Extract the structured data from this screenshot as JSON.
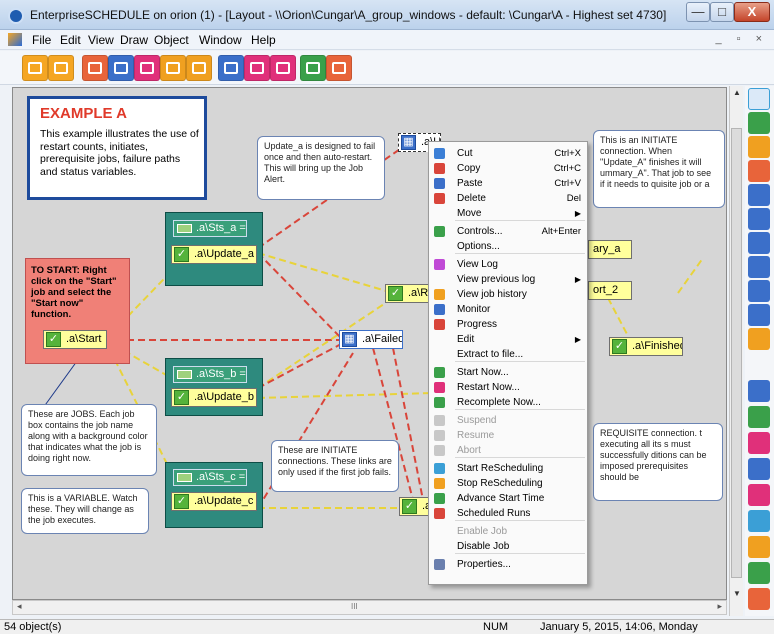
{
  "window": {
    "title": "EnterpriseSCHEDULE on orion  (1) - [Layout - \\\\Orion\\Cungar\\A_group_windows - default: \\Cungar\\A - Highest set 4730]",
    "minimize": "—",
    "maximize": "□",
    "close": "X"
  },
  "menubar": {
    "items": [
      "File",
      "Edit",
      "View",
      "Draw",
      "Object",
      "Window",
      "Help"
    ],
    "mdi_controls": "_ ▫ ×"
  },
  "toolbar": {
    "colors": [
      "#f5a623",
      "#f5a623",
      "#e8643a",
      "#3b6fc9",
      "#e0307a",
      "#f0a020",
      "#f0a020",
      "#3b6fc9",
      "#e0307a",
      "#e0307a",
      "#3aa04a",
      "#e8643a"
    ]
  },
  "diagram": {
    "example_title": "EXAMPLE A",
    "example_text": "This example illustrates the use of restart counts, initiates, prerequisite jobs, failure paths and status variables.",
    "start_note": "TO START: Right click on the \"Start\" job and select the \"Start now\" function.",
    "jobs": {
      "start": ".a\\Start",
      "update_a": ".a\\Update_a",
      "update_b": ".a\\Update_b",
      "update_c": ".a\\Update_c",
      "rep": ".a\\Rep",
      "failed": ".a\\Failed",
      "finished": ".a\\Finished",
      "update_a_failed": ".a\\Update_a_failed",
      "ary_a": "ary_a",
      "ort_2": "ort_2",
      "al": ".a\\"
    },
    "vars": {
      "sts_a": ".a\\Sts_a =",
      "sts_b": ".a\\Sts_b =",
      "sts_c": ".a\\Sts_c ="
    },
    "notes": {
      "update_note": "Update_a is designed to fail once and then auto-restart. This will bring up the Job Alert.",
      "initiate_note": "This is an INITIATE connection.  When \"Update_A\" finishes it will ummary_A\". That job  to see if it needs to quisite job or a",
      "jobs_note": "These are JOBS.  Each job box contains the job name along with a background color that indicates what the job is doing right now.",
      "initiate_conn_note": "These are INITIATE connections.  These links are only used if the first job fails.",
      "prereq_note": "REQUISITE connection. t executing all its s must successfully ditions can be imposed prerequisites should be",
      "variable_note": "This is a VARIABLE.  Watch these. They will change as the job executes."
    }
  },
  "context_menu": {
    "items": [
      {
        "label": "Cut",
        "shortcut": "Ctrl+X",
        "icon": "cut-icon",
        "color": "#3b7fd6",
        "disabled": false
      },
      {
        "label": "Copy",
        "shortcut": "Ctrl+C",
        "icon": "copy-icon",
        "color": "#d9453a",
        "disabled": false
      },
      {
        "label": "Paste",
        "shortcut": "Ctrl+V",
        "icon": "paste-icon",
        "color": "#3b6fc9",
        "disabled": false
      },
      {
        "label": "Delete",
        "shortcut": "Del",
        "icon": "delete-icon",
        "color": "#d9453a",
        "disabled": false
      },
      {
        "label": "Move",
        "shortcut": "",
        "icon": "",
        "color": "",
        "disabled": false,
        "submenu": true
      },
      {
        "label": "Controls...",
        "shortcut": "Alt+Enter",
        "icon": "controls-icon",
        "color": "#3aa04a",
        "disabled": false
      },
      {
        "label": "Options...",
        "shortcut": "",
        "icon": "",
        "color": "",
        "disabled": false
      },
      {
        "label": "View Log",
        "shortcut": "",
        "icon": "log-icon",
        "color": "#c04ad6",
        "disabled": false
      },
      {
        "label": "View previous log",
        "shortcut": "",
        "icon": "",
        "color": "",
        "disabled": false,
        "submenu": true
      },
      {
        "label": "View job history",
        "shortcut": "",
        "icon": "history-icon",
        "color": "#f0a020",
        "disabled": false
      },
      {
        "label": "Monitor",
        "shortcut": "",
        "icon": "monitor-icon",
        "color": "#3b6fc9",
        "disabled": false
      },
      {
        "label": "Progress",
        "shortcut": "",
        "icon": "progress-icon",
        "color": "#d9453a",
        "disabled": false
      },
      {
        "label": "Edit",
        "shortcut": "",
        "icon": "",
        "color": "",
        "disabled": false,
        "submenu": true
      },
      {
        "label": "Extract to file...",
        "shortcut": "",
        "icon": "",
        "color": "",
        "disabled": false
      },
      {
        "label": "Start Now...",
        "shortcut": "",
        "icon": "start-icon",
        "color": "#3aa04a",
        "disabled": false
      },
      {
        "label": "Restart Now...",
        "shortcut": "",
        "icon": "restart-icon",
        "color": "#e0307a",
        "disabled": false
      },
      {
        "label": "Recomplete Now...",
        "shortcut": "",
        "icon": "recomplete-icon",
        "color": "#3aa04a",
        "disabled": false
      },
      {
        "label": "Suspend",
        "shortcut": "",
        "icon": "suspend-icon",
        "color": "#c8c8c8",
        "disabled": true
      },
      {
        "label": "Resume",
        "shortcut": "",
        "icon": "resume-icon",
        "color": "#c8c8c8",
        "disabled": true
      },
      {
        "label": "Abort",
        "shortcut": "",
        "icon": "abort-icon",
        "color": "#c8c8c8",
        "disabled": true
      },
      {
        "label": "Start ReScheduling",
        "shortcut": "",
        "icon": "start-rescheduling-icon",
        "color": "#3b9fd6",
        "disabled": false
      },
      {
        "label": "Stop ReScheduling",
        "shortcut": "",
        "icon": "stop-rescheduling-icon",
        "color": "#f0a020",
        "disabled": false
      },
      {
        "label": "Advance Start Time",
        "shortcut": "",
        "icon": "advance-time-icon",
        "color": "#3aa04a",
        "disabled": false
      },
      {
        "label": "Scheduled Runs",
        "shortcut": "",
        "icon": "calendar-icon",
        "color": "#d9453a",
        "disabled": false
      },
      {
        "label": "Enable Job",
        "shortcut": "",
        "icon": "",
        "color": "",
        "disabled": true
      },
      {
        "label": "Disable Job",
        "shortcut": "",
        "icon": "",
        "color": "",
        "disabled": false
      },
      {
        "label": "Properties...",
        "shortcut": "",
        "icon": "properties-icon",
        "color": "#6a7fae",
        "disabled": false
      }
    ]
  },
  "rightbar": {
    "colors": [
      "#3b9fd6",
      "#3aa04a",
      "#f0a020",
      "#e8643a",
      "#3b6fc9",
      "#3b6fc9",
      "#3b6fc9",
      "#3b6fc9",
      "#3b6fc9",
      "#3b6fc9",
      "#f0a020",
      "#3b6fc9",
      "#3aa04a",
      "#e0307a",
      "#3b6fc9",
      "#e0307a",
      "#3b9fd6",
      "#f0a020",
      "#3aa04a",
      "#e8643a"
    ]
  },
  "status": {
    "objects": "54 object(s)",
    "num": "NUM",
    "datetime": "January 5, 2015, 14:06, Monday"
  },
  "hscroll": {
    "center": "III"
  }
}
